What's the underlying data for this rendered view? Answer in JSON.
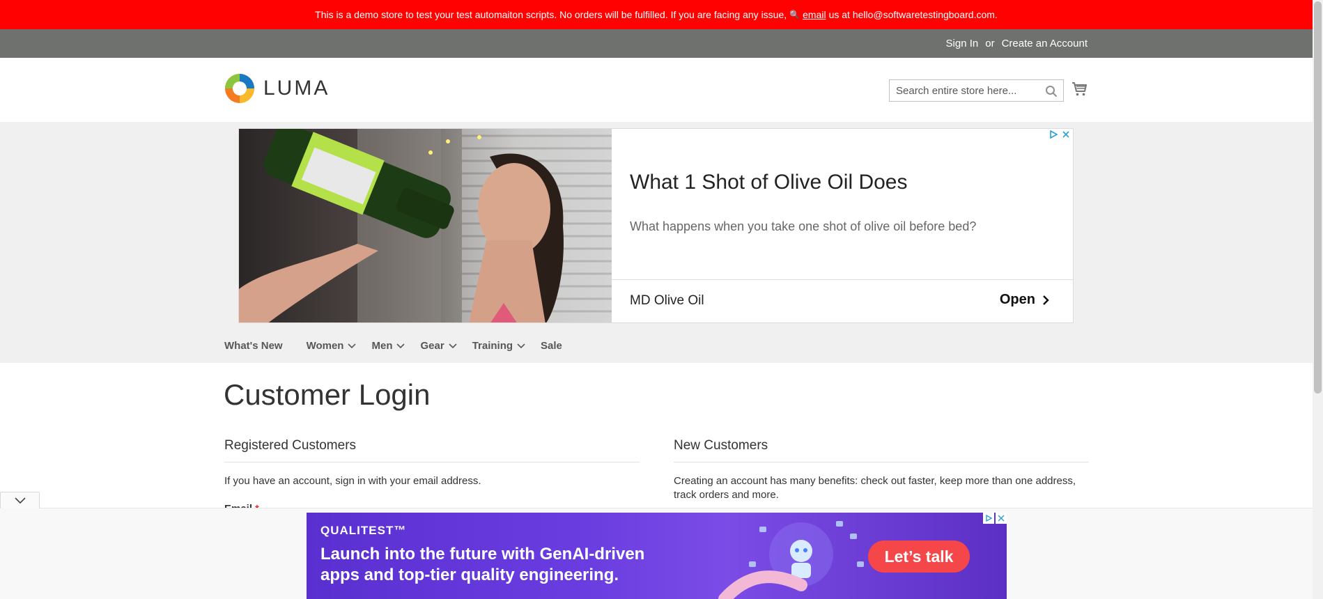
{
  "demo_notice": {
    "text_before": "This is a demo store to test your test automaiton scripts. No orders will be fulfilled. If you are facing any issue,",
    "email_link": "email",
    "text_after": "us at hello@softwaretestingboard.com."
  },
  "panel": {
    "sign_in": "Sign In",
    "or": "or",
    "create_account": "Create an Account"
  },
  "header": {
    "logo_text": "LUMA",
    "search_placeholder": "Search entire store here...",
    "search_value": ""
  },
  "ad": {
    "title": "What 1 Shot of Olive Oil Does",
    "description": "What happens when you take one shot of olive oil before bed?",
    "brand": "MD Olive Oil",
    "cta": "Open"
  },
  "nav": {
    "items": [
      {
        "label": "What's New",
        "has_dropdown": false
      },
      {
        "label": "Women",
        "has_dropdown": true
      },
      {
        "label": "Men",
        "has_dropdown": true
      },
      {
        "label": "Gear",
        "has_dropdown": true
      },
      {
        "label": "Training",
        "has_dropdown": true
      },
      {
        "label": "Sale",
        "has_dropdown": false
      }
    ]
  },
  "page": {
    "title": "Customer Login"
  },
  "registered": {
    "title": "Registered Customers",
    "text": "If you have an account, sign in with your email address.",
    "email_label": "Email",
    "required_mark": "*"
  },
  "new_customers": {
    "title": "New Customers",
    "text": "Creating an account has many benefits: check out faster, keep more than one address, track orders and more."
  },
  "bottom_ad": {
    "brand": "QUALITEST™",
    "line1": "Launch into the future with GenAI-driven",
    "line2": "apps and top-tier quality engineering.",
    "cta": "Let’s talk"
  },
  "colors": {
    "demo_bar": "#ff0101",
    "panel_header": "#6e716e",
    "page_bg_gray": "#f0f0f0",
    "required": "#e02b27"
  }
}
